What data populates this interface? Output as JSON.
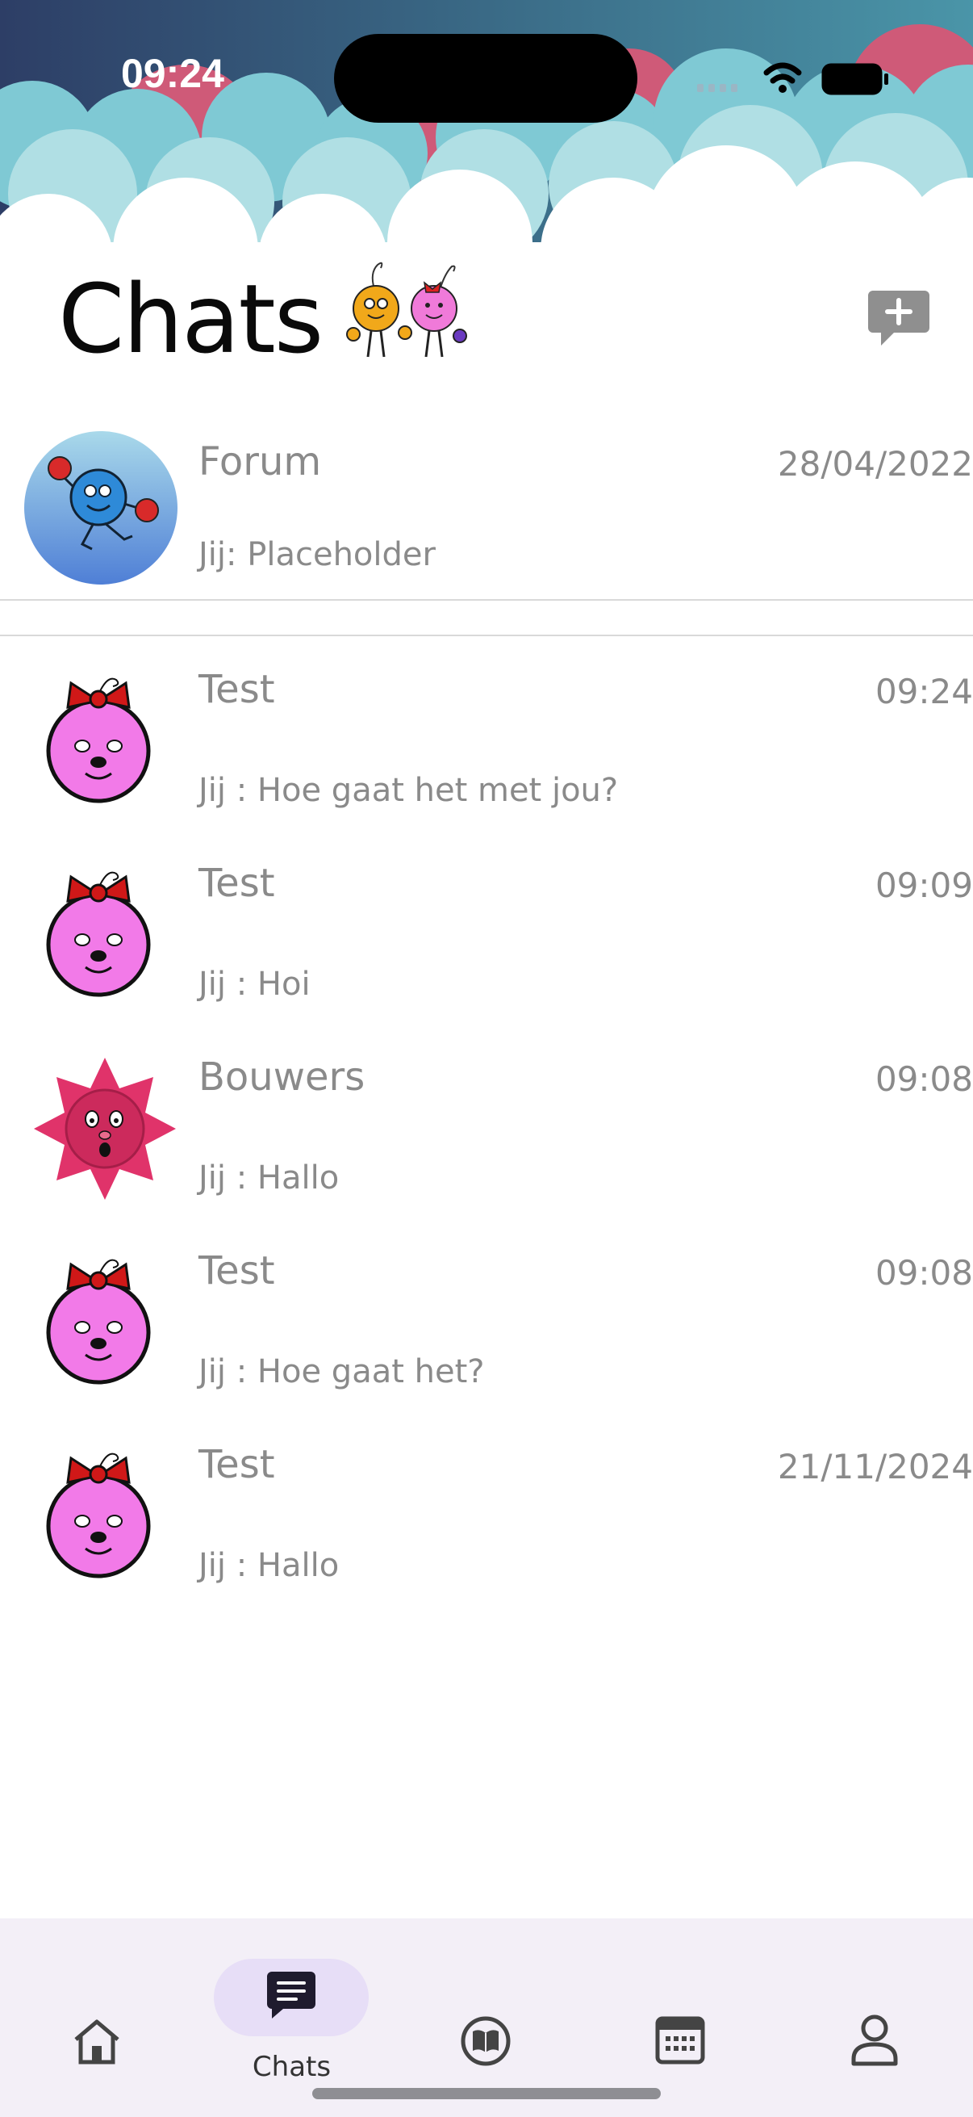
{
  "status_bar": {
    "time": "09:24"
  },
  "header": {
    "title": "Chats"
  },
  "forum": {
    "name": "Forum",
    "date": "28/04/2022",
    "message": "Jij: Placeholder"
  },
  "chats": [
    {
      "name": "Test",
      "time": "09:24",
      "message": "Jij : Hoe gaat het met jou?",
      "avatar": "pink-bow-avatar"
    },
    {
      "name": "Test",
      "time": "09:09",
      "message": "Jij : Hoi",
      "avatar": "pink-bow-avatar"
    },
    {
      "name": "Bouwers",
      "time": "09:08",
      "message": "Jij : Hallo",
      "avatar": "red-star-avatar"
    },
    {
      "name": "Test",
      "time": "09:08",
      "message": "Jij : Hoe gaat het?",
      "avatar": "pink-bow-avatar"
    },
    {
      "name": "Test",
      "time": "21/11/2024",
      "message": "Jij : Hallo",
      "avatar": "pink-bow-avatar"
    }
  ],
  "tabbar": {
    "active": "chats",
    "tabs": [
      {
        "id": "home",
        "icon": "home-icon"
      },
      {
        "id": "chats",
        "icon": "chat-icon",
        "label": "Chats"
      },
      {
        "id": "library",
        "icon": "book-icon"
      },
      {
        "id": "calendar",
        "icon": "calendar-icon"
      },
      {
        "id": "profile",
        "icon": "person-icon"
      }
    ]
  },
  "colors": {
    "text_muted": "#8a8a8a",
    "tab_active_pill": "#e7def7",
    "tabbar_bg": "#f3eff7"
  }
}
